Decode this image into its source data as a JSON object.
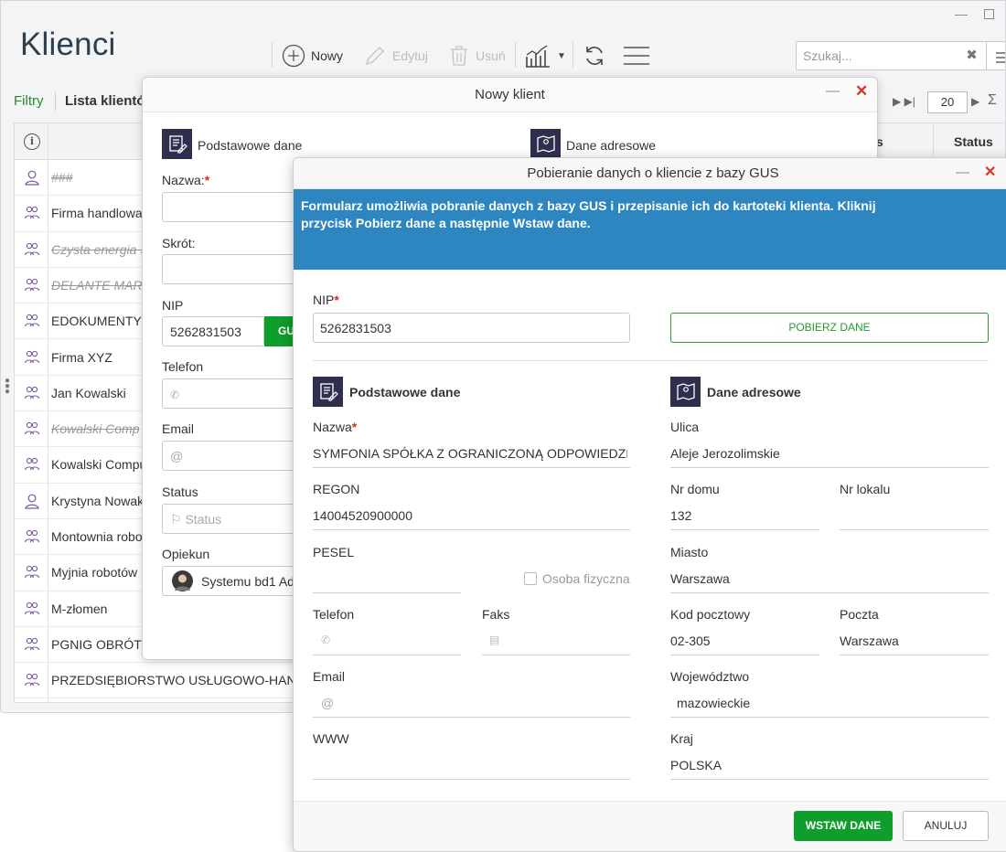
{
  "app": {
    "title": "Klienci",
    "toolbar": {
      "new_label": "Nowy",
      "edit_label": "Edytuj",
      "delete_label": "Usuń",
      "search_placeholder": "Szukaj..."
    },
    "tabs": {
      "filters": "Filtry",
      "list": "Lista klientó"
    },
    "pager": {
      "page_size": "20"
    },
    "grid": {
      "col_s": "s",
      "col_status": "Status",
      "rows": [
        {
          "name": "###",
          "strike": true,
          "type": "person"
        },
        {
          "name": "Firma handlowa",
          "strike": false,
          "type": "company"
        },
        {
          "name": "Czysta energia S",
          "strike": true,
          "type": "company"
        },
        {
          "name": "DELANTE MARI",
          "strike": true,
          "type": "company"
        },
        {
          "name": "EDOKUMENTY S",
          "strike": false,
          "type": "company"
        },
        {
          "name": "Firma XYZ",
          "strike": false,
          "type": "company"
        },
        {
          "name": "Jan Kowalski",
          "strike": false,
          "type": "company"
        },
        {
          "name": "Kowalski Comp",
          "strike": true,
          "type": "company"
        },
        {
          "name": "Kowalski Compu",
          "strike": false,
          "type": "company"
        },
        {
          "name": "Krystyna Nowak",
          "strike": false,
          "type": "person"
        },
        {
          "name": "Montownia robo",
          "strike": false,
          "type": "company"
        },
        {
          "name": "Myjnia robotów",
          "strike": false,
          "type": "company"
        },
        {
          "name": "M-złomen",
          "strike": false,
          "type": "company"
        },
        {
          "name": "PGNIG OBRÓT D",
          "strike": false,
          "type": "company"
        },
        {
          "name": "PRZEDSIĘBIORSTWO USŁUGOWO-HANDL",
          "strike": false,
          "type": "company"
        }
      ]
    }
  },
  "dialog_new_client": {
    "title": "Nowy klient",
    "section_basic": "Podstawowe dane",
    "section_address": "Dane adresowe",
    "name_label": "Nazwa:",
    "short_label": "Skrót:",
    "nip_label": "NIP",
    "nip_value": "5262831503",
    "gus_button": "GU",
    "phone_label": "Telefon",
    "email_label": "Email",
    "email_placeholder": "@",
    "status_label": "Status",
    "status_placeholder": "Status",
    "owner_label": "Opiekun",
    "owner_value": "Systemu bd1 Ad"
  },
  "dialog_gus": {
    "title": "Pobieranie danych o kliencie z bazy GUS",
    "banner_line1": "Formularz umożliwia pobranie danych z bazy GUS i przepisanie ich do kartoteki klienta. Kliknij",
    "banner_line2": "przycisk Pobierz dane a następnie Wstaw dane.",
    "nip_label": "NIP",
    "nip_value": "5262831503",
    "fetch_button": "POBIERZ DANE",
    "section_basic": "Podstawowe dane",
    "section_address": "Dane adresowe",
    "fields": {
      "name_label": "Nazwa",
      "name_value": "SYMFONIA SPÓŁKA Z OGRANICZONĄ ODPOWIEDZIAI",
      "regon_label": "REGON",
      "regon_value": "14004520900000",
      "pesel_label": "PESEL",
      "pesel_value": "",
      "person_checkbox": "Osoba fizyczna",
      "phone_label": "Telefon",
      "fax_label": "Faks",
      "email_label": "Email",
      "email_placeholder": "@",
      "www_label": "WWW",
      "street_label": "Ulica",
      "street_value": "Aleje Jerozolimskie",
      "house_label": "Nr domu",
      "house_value": "132",
      "flat_label": "Nr lokalu",
      "flat_value": "",
      "city_label": "Miasto",
      "city_value": "Warszawa",
      "zip_label": "Kod pocztowy",
      "zip_value": "02-305",
      "post_label": "Poczta",
      "post_value": "Warszawa",
      "voiv_label": "Województwo",
      "voiv_value": "mazowieckie",
      "country_label": "Kraj",
      "country_value": "POLSKA"
    },
    "insert_button": "WSTAW DANE",
    "cancel_button": "ANULUJ"
  },
  "colors": {
    "accent_green": "#0f9d2c",
    "banner_blue": "#2e86c1",
    "close_red": "#d9342b",
    "section_icon_bg": "#2e2e4e"
  }
}
